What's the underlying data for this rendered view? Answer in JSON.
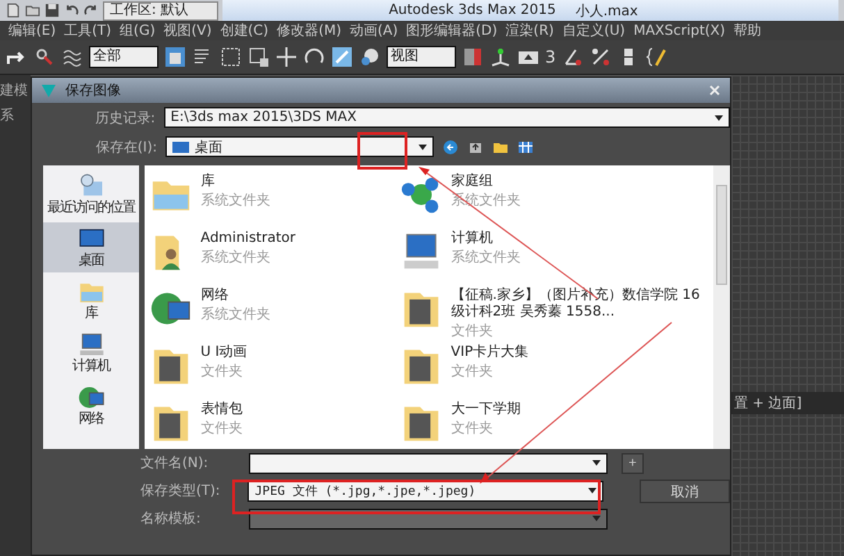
{
  "app": {
    "workspace": "工作区: 默认",
    "title": "Autodesk 3ds Max  2015",
    "file": "小人.max",
    "menu": [
      "编辑(E)",
      "工具(T)",
      "组(G)",
      "视图(V)",
      "创建(C)",
      "修改器(M)",
      "动画(A)",
      "图形编辑器(D)",
      "渲染(R)",
      "自定义(U)",
      "MAXScript(X)",
      "帮助"
    ],
    "selection_filter": "全部",
    "coord_system": "视图",
    "snap_label": "3",
    "side_labels": [
      "建模",
      "系"
    ],
    "viewport_label": "置 + 边面]"
  },
  "dialog": {
    "title": "保存图像",
    "history_label": "历史记录:",
    "history_value": "E:\\3ds max 2015\\3DS MAX",
    "save_in_label": "保存在(I):",
    "save_in_value": "桌面",
    "places": [
      {
        "label": "最近访问的位置",
        "kind": "recent",
        "selected": false
      },
      {
        "label": "桌面",
        "kind": "desktop",
        "selected": true
      },
      {
        "label": "库",
        "kind": "library",
        "selected": false
      },
      {
        "label": "计算机",
        "kind": "computer",
        "selected": false
      },
      {
        "label": "网络",
        "kind": "network",
        "selected": false
      }
    ],
    "files": [
      {
        "name": "库",
        "type": "系统文件夹",
        "kind": "library"
      },
      {
        "name": "家庭组",
        "type": "系统文件夹",
        "kind": "homegroup"
      },
      {
        "name": "Administrator",
        "type": "系统文件夹",
        "kind": "user"
      },
      {
        "name": "计算机",
        "type": "系统文件夹",
        "kind": "computer"
      },
      {
        "name": "网络",
        "type": "系统文件夹",
        "kind": "network"
      },
      {
        "name": "【征稿.家乡】（图片补充）数信学院 16级计科2班 吴秀蓁 1558...",
        "type": "文件夹",
        "kind": "folder"
      },
      {
        "name": "U I动画",
        "type": "文件夹",
        "kind": "folder"
      },
      {
        "name": "VIP卡片大集",
        "type": "文件夹",
        "kind": "folder"
      },
      {
        "name": "表情包",
        "type": "文件夹",
        "kind": "folder"
      },
      {
        "name": "大一下学期",
        "type": "文件夹",
        "kind": "folder"
      }
    ],
    "filename_label": "文件名(N):",
    "add_button": "+",
    "type_label": "保存类型(T):",
    "type_value": "JPEG 文件 (*.jpg,*.jpe,*.jpeg)",
    "template_label": "名称模板:",
    "cancel_button": "取消"
  }
}
